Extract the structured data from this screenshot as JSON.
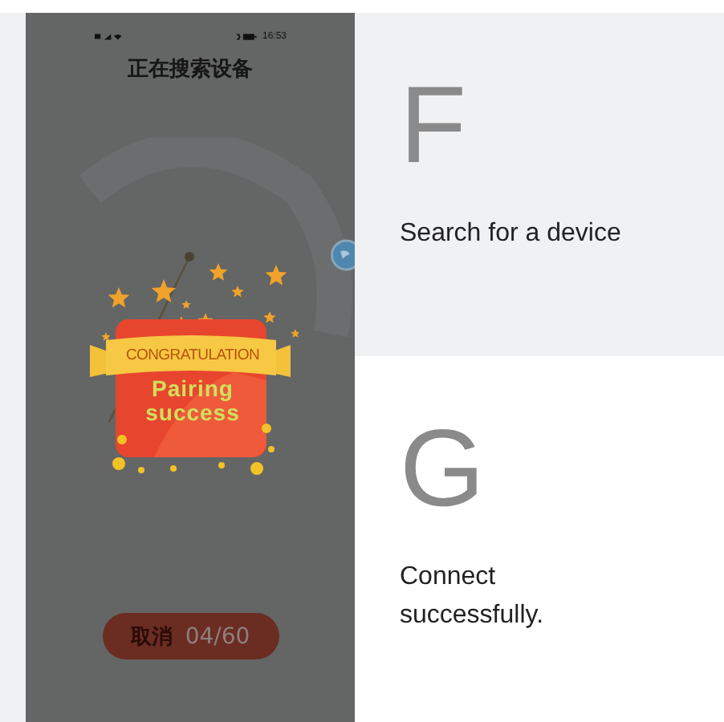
{
  "status_bar": {
    "time": "16:53"
  },
  "phone_title": "正在搜索设备",
  "popup": {
    "ribbon": "CONGRATULATION",
    "message": "Pairing success"
  },
  "cancel_button": {
    "label": "取消",
    "counter": "04/60"
  },
  "steps": [
    {
      "letter": "F",
      "caption": "Search for a device",
      "highlighted": true
    },
    {
      "letter": "G",
      "caption": "Connect successfully.",
      "highlighted": false
    }
  ]
}
